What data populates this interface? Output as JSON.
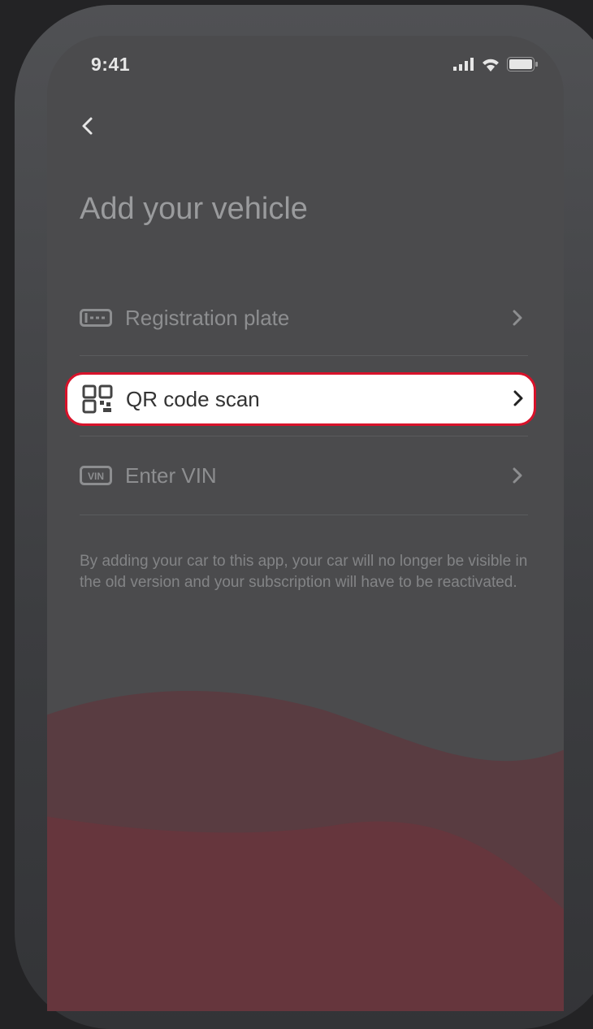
{
  "status_bar": {
    "time": "9:41"
  },
  "page": {
    "title": "Add your vehicle"
  },
  "menu": {
    "items": [
      {
        "label": "Registration plate",
        "icon": "license-plate-icon"
      },
      {
        "label": "QR code scan",
        "icon": "qr-code-icon",
        "highlighted": true
      },
      {
        "label": "Enter VIN",
        "icon": "vin-icon",
        "icon_text": "VIN"
      }
    ]
  },
  "disclaimer": "By adding your car to this app, your car will no longer be visible in the old version and your subscription will have to be reactivated.",
  "colors": {
    "accent": "#d8122a",
    "background": "#4b4b4d",
    "highlight_bg": "#ffffff"
  }
}
